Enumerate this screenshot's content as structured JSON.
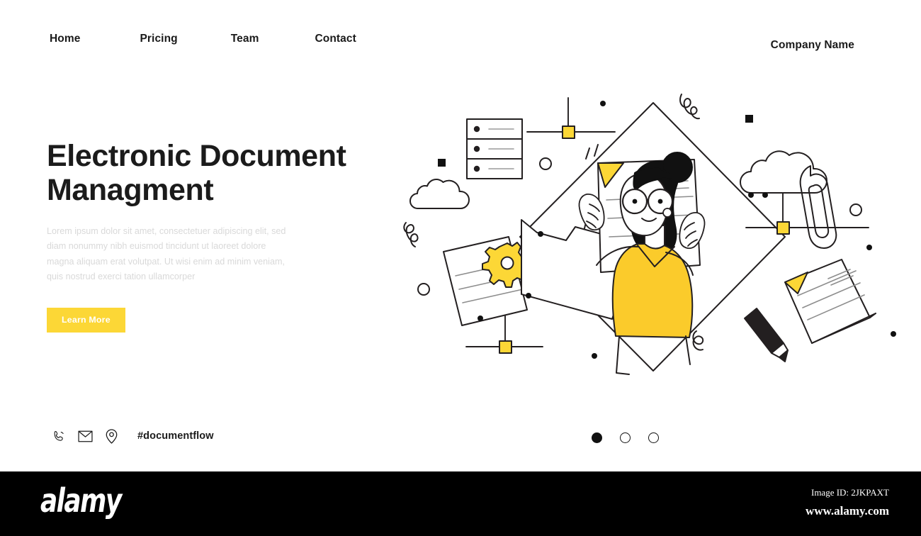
{
  "nav": {
    "items": [
      {
        "label": "Home"
      },
      {
        "label": "Pricing"
      },
      {
        "label": "Team"
      },
      {
        "label": "Contact"
      }
    ],
    "brand": "Company Name"
  },
  "hero": {
    "title_line1": "Electronic Document",
    "title_line2": "Managment",
    "body": "Lorem ipsum dolor sit amet, consectetuer adipiscing elit, sed diam nonummy nibh euismod tincidunt ut laoreet dolore magna aliquam erat volutpat. Ut wisi enim ad minim veniam, quis nostrud exerci tation ullamcorper",
    "cta_label": "Learn More"
  },
  "contact": {
    "icons": [
      {
        "name": "phone-icon"
      },
      {
        "name": "envelope-icon"
      },
      {
        "name": "location-pin-icon"
      }
    ],
    "hashtag": "#documentflow"
  },
  "carousel": {
    "dots": [
      {
        "active": true
      },
      {
        "active": false
      },
      {
        "active": false
      }
    ]
  },
  "illustration": {
    "alt": "woman holding document with cloud, folder, gear, paperclip and server icons",
    "elements": [
      "diamond-outline",
      "woman-figure",
      "held-document",
      "server-stack-icon",
      "cloud-large-icon",
      "cloud-small-icon",
      "folder-icon",
      "gear-document-icon",
      "tilted-document-icon",
      "paperclip-icon",
      "pencil-icon",
      "connector-node-top",
      "connector-node-right",
      "connector-node-bottom",
      "squiggle-top",
      "squiggle-left",
      "squiggle-bottom"
    ]
  },
  "colors": {
    "yellow": "#FCD736",
    "yellow_deep": "#FBCB2B",
    "ink": "#1b1b1b",
    "body_text": "#d9d9d9"
  },
  "watermark": {
    "logo": "alamy",
    "image_id": "Image ID: 2JKPAXT",
    "url": "www.alamy.com"
  }
}
